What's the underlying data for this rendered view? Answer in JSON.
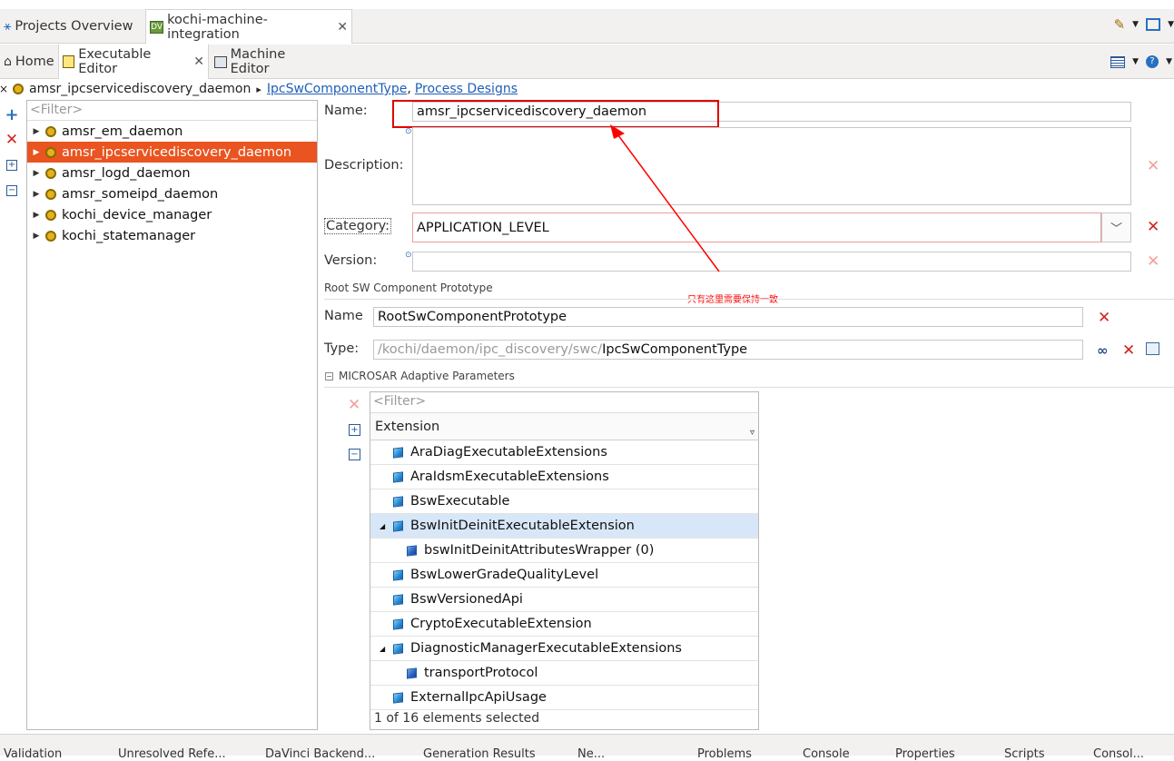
{
  "outer_tabs": [
    {
      "label": "Projects Overview",
      "active": false
    },
    {
      "label": "kochi-machine-integration",
      "active": true,
      "closable": true
    }
  ],
  "inner_tabs": [
    {
      "label": "Home"
    },
    {
      "label": "Executable Editor",
      "active": true,
      "closable": true
    },
    {
      "label": "Machine Editor"
    }
  ],
  "breadcrumb": {
    "item": "amsr_ipcservicediscovery_daemon",
    "sep": ",",
    "links": [
      "IpcSwComponentType",
      "Process Designs"
    ]
  },
  "tree": {
    "filter_placeholder": "<Filter>",
    "items": [
      {
        "label": "amsr_em_daemon",
        "selected": false
      },
      {
        "label": "amsr_ipcservicediscovery_daemon",
        "selected": true
      },
      {
        "label": "amsr_logd_daemon",
        "selected": false
      },
      {
        "label": "amsr_someipd_daemon",
        "selected": false
      },
      {
        "label": "kochi_device_manager",
        "selected": false
      },
      {
        "label": "kochi_statemanager",
        "selected": false
      }
    ]
  },
  "form": {
    "name_label": "Name:",
    "name_value": "amsr_ipcservicediscovery_daemon",
    "description_label": "Description:",
    "description_value": "",
    "category_label": "Category:",
    "category_value": "APPLICATION_LEVEL",
    "version_label": "Version:",
    "version_value": ""
  },
  "root_sw": {
    "section_title": "Root SW Component Prototype",
    "name_label": "Name",
    "name_value": "RootSwComponentPrototype",
    "type_label": "Type:",
    "type_path": "/kochi/daemon/ipc_discovery/swc/",
    "type_value": "IpcSwComponentType"
  },
  "annotation": {
    "text": "只有这里需要保持一致",
    "color": "#ff0000"
  },
  "microsar": {
    "section_title": "MICROSAR Adaptive Parameters",
    "filter_placeholder": "<Filter>",
    "column_header": "Extension",
    "rows": [
      {
        "label": "AraDiagExecutableExtensions",
        "level": 0,
        "expanded": null,
        "selected": false
      },
      {
        "label": "AraIdsmExecutableExtensions",
        "level": 0,
        "expanded": null,
        "selected": false
      },
      {
        "label": "BswExecutable",
        "level": 0,
        "expanded": null,
        "selected": false
      },
      {
        "label": "BswInitDeinitExecutableExtension",
        "level": 0,
        "expanded": true,
        "selected": true
      },
      {
        "label": "bswInitDeinitAttributesWrapper (0)",
        "level": 1,
        "expanded": null,
        "selected": false
      },
      {
        "label": "BswLowerGradeQualityLevel",
        "level": 0,
        "expanded": null,
        "selected": false
      },
      {
        "label": "BswVersionedApi",
        "level": 0,
        "expanded": null,
        "selected": false
      },
      {
        "label": "CryptoExecutableExtension",
        "level": 0,
        "expanded": null,
        "selected": false
      },
      {
        "label": "DiagnosticManagerExecutableExtensions",
        "level": 0,
        "expanded": true,
        "selected": false
      },
      {
        "label": "transportProtocol",
        "level": 1,
        "expanded": null,
        "selected": false
      },
      {
        "label": "ExternalIpcApiUsage",
        "level": 0,
        "expanded": null,
        "selected": false
      }
    ],
    "status": "1 of 16 elements selected"
  },
  "bottom_tabs": [
    "Validation",
    "Unresolved Refe...",
    "DaVinci Backend...",
    "Generation Results",
    "Ne...",
    "Problems",
    "Console",
    "Properties",
    "Scripts",
    "Consol..."
  ],
  "colors": {
    "selection": "#e95420",
    "highlight_box": "#e00000",
    "link": "#1f5fb8",
    "delete_icon": "#d2231c"
  }
}
